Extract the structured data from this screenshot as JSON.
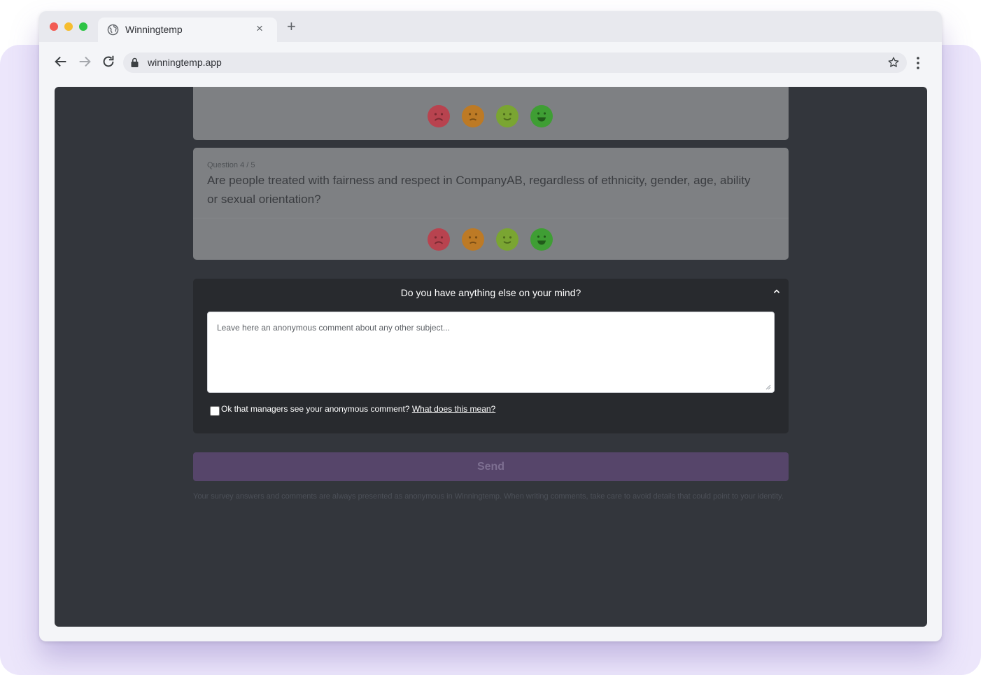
{
  "browser": {
    "tab_title": "Winningtemp",
    "tab_close_glyph": "×",
    "new_tab_glyph": "+",
    "url": "winningtemp.app",
    "icons": [
      "globe-icon",
      "back-arrow-icon",
      "forward-arrow-icon",
      "reload-icon",
      "lock-icon",
      "star-icon",
      "kebab-menu-icon"
    ]
  },
  "survey": {
    "question": {
      "counter": "Question 4 / 5",
      "text": "Are people treated with fairness and respect in CompanyAB, regardless of ethnicity, gender, age, ability or sexual orientation?"
    },
    "rating_faces": [
      {
        "name": "very-unhappy",
        "color": "#b8434f"
      },
      {
        "name": "unhappy",
        "color": "#bd7a25"
      },
      {
        "name": "happy",
        "color": "#7aa532"
      },
      {
        "name": "very-happy",
        "color": "#3f9e34"
      }
    ],
    "comment": {
      "title": "Do you have anything else on your mind?",
      "placeholder": "Leave here an anonymous comment about any other subject...",
      "consent_text": "Ok that managers see your anonymous comment?",
      "consent_link": "What does this mean?"
    },
    "send_label": "Send",
    "footnote": "Your survey answers and comments are always presented as anonymous in Winningtemp. When writing comments, take care to avoid details that could point to your identity."
  },
  "colors": {
    "accent": "#56456a",
    "backdrop": "#ece6fb",
    "page_bg": "#33363c"
  }
}
